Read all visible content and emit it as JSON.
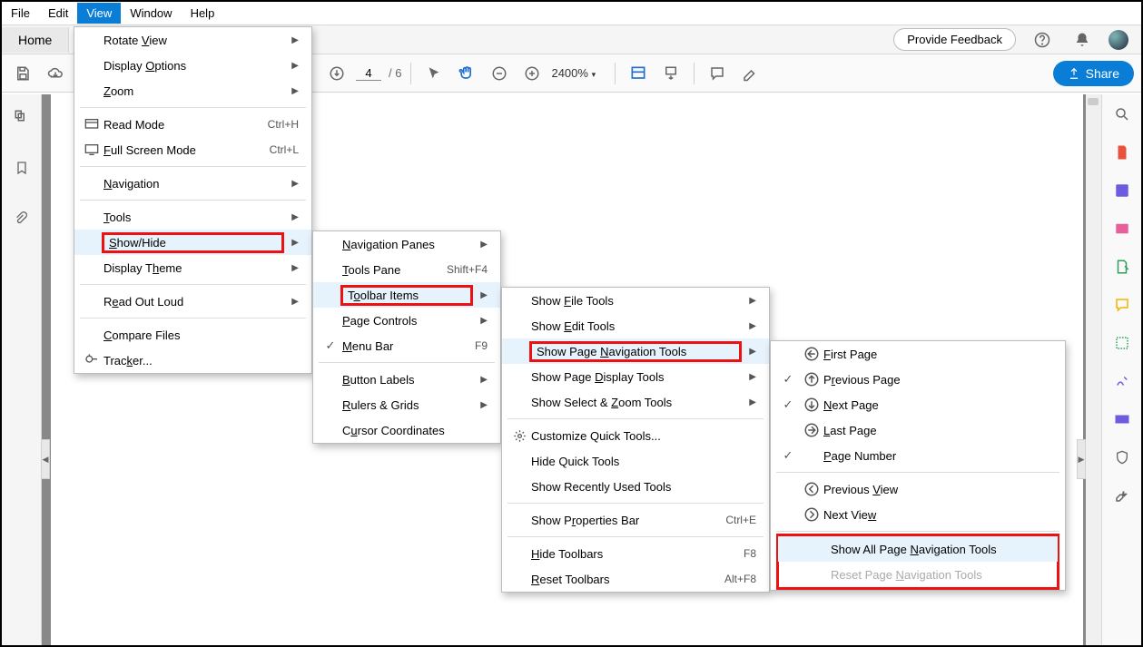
{
  "menubar": {
    "items": [
      "File",
      "Edit",
      "View",
      "Window",
      "Help"
    ],
    "active_index": 2
  },
  "tab": {
    "home": "Home"
  },
  "header": {
    "feedback": "Provide Feedback",
    "share": "Share"
  },
  "toolbar": {
    "page_current": "4",
    "page_total": "/  6",
    "zoom": "2400%"
  },
  "view_menu": {
    "rotate": "Rotate View",
    "display_options": "Display Options",
    "zoom": "Zoom",
    "read_mode": "Read Mode",
    "read_mode_accel": "Ctrl+H",
    "full_screen": "Full Screen Mode",
    "full_screen_accel": "Ctrl+L",
    "navigation": "Navigation",
    "tools": "Tools",
    "show_hide": "Show/Hide",
    "display_theme": "Display Theme",
    "read_out": "Read Out Loud",
    "compare": "Compare Files",
    "tracker": "Tracker..."
  },
  "showhide_menu": {
    "nav_panes": "Navigation Panes",
    "tools_pane": "Tools Pane",
    "tools_pane_accel": "Shift+F4",
    "toolbar_items": "Toolbar Items",
    "page_controls": "Page Controls",
    "menu_bar": "Menu Bar",
    "menu_bar_accel": "F9",
    "button_labels": "Button Labels",
    "rulers": "Rulers & Grids",
    "cursor": "Cursor Coordinates"
  },
  "toolbar_items_menu": {
    "file_tools": "Show File Tools",
    "edit_tools": "Show Edit Tools",
    "page_nav": "Show Page Navigation Tools",
    "page_display": "Show Page Display Tools",
    "select_zoom": "Show Select & Zoom Tools",
    "customize": "Customize Quick Tools...",
    "hide_quick": "Hide Quick Tools",
    "show_recent": "Show Recently Used Tools",
    "props_bar": "Show Properties Bar",
    "props_accel": "Ctrl+E",
    "hide_toolbars": "Hide Toolbars",
    "hide_accel": "F8",
    "reset_toolbars": "Reset Toolbars",
    "reset_accel": "Alt+F8"
  },
  "page_nav_menu": {
    "first": "First Page",
    "prev": "Previous Page",
    "next": "Next Page",
    "last": "Last Page",
    "page_no": "Page Number",
    "prev_view": "Previous View",
    "next_view": "Next View",
    "show_all": "Show All Page Navigation Tools",
    "reset": "Reset Page Navigation Tools"
  }
}
